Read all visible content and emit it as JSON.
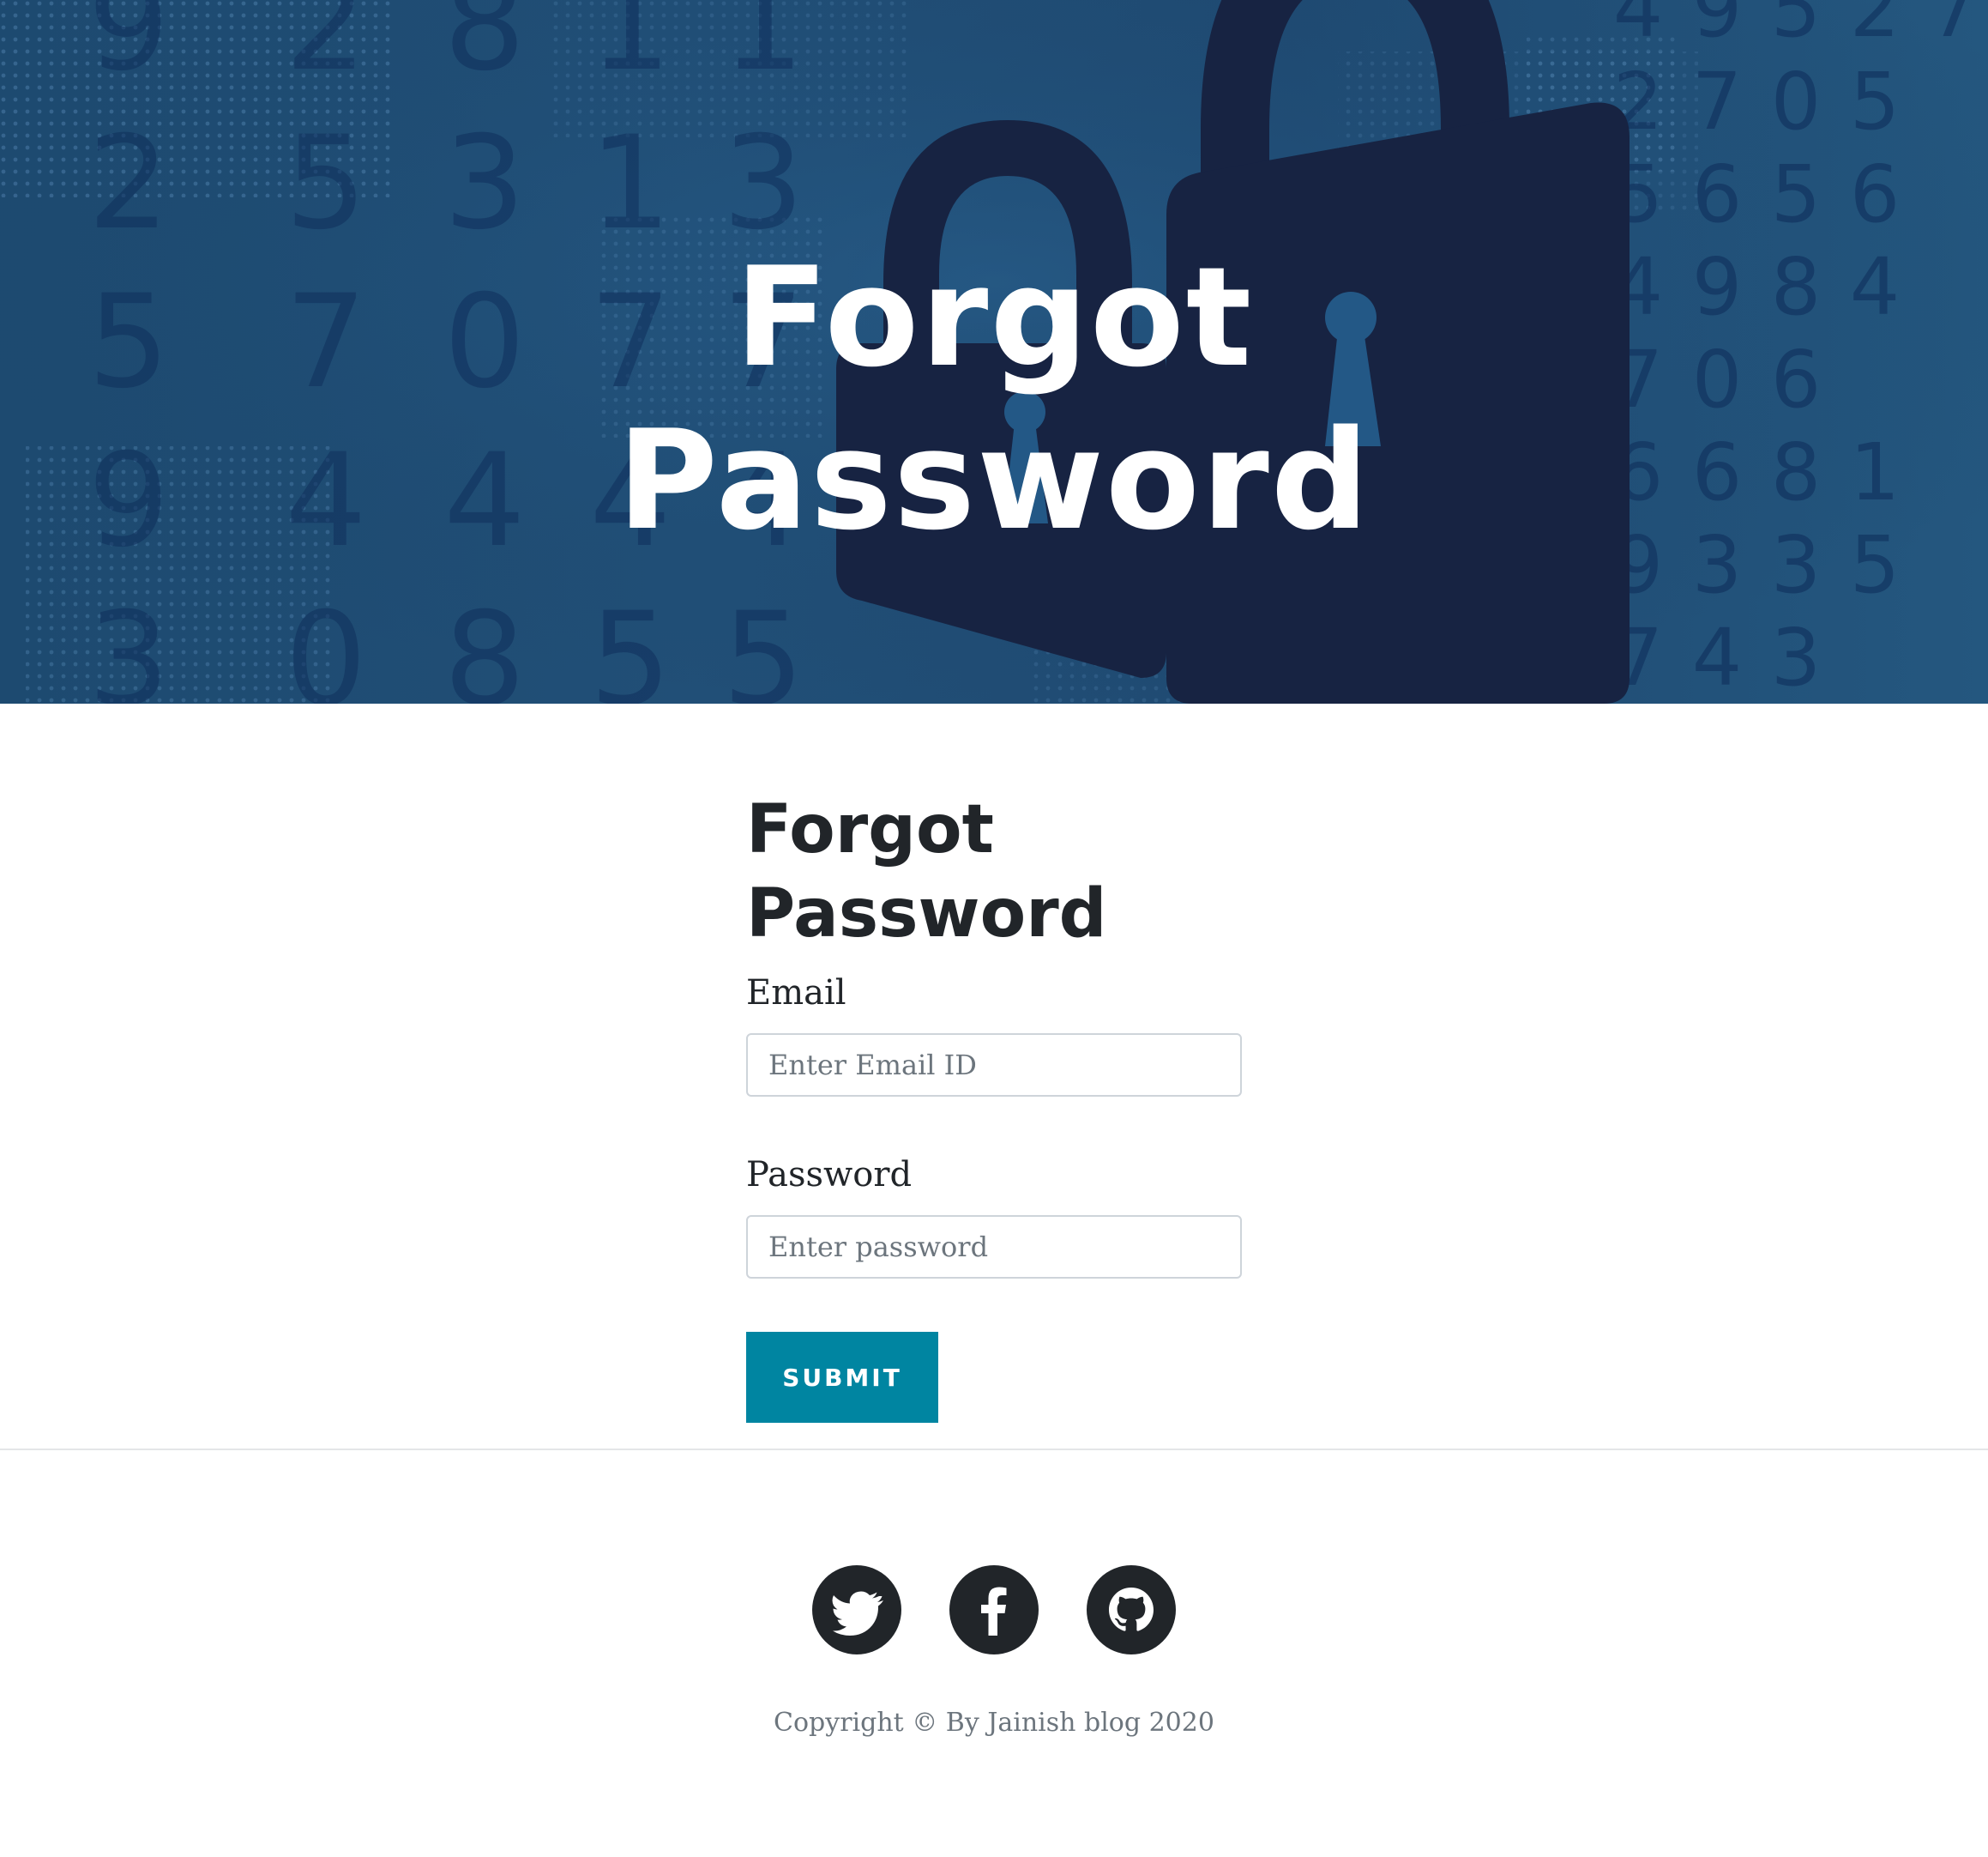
{
  "hero": {
    "title_line1": "Forgot",
    "title_line2": "Password",
    "background_icon": "padlock-icon",
    "background_digits": [
      [
        "9",
        "2",
        "8",
        "1"
      ],
      [
        "2",
        "5",
        "3",
        "1",
        "3"
      ],
      [
        "5",
        "7",
        "0",
        "7"
      ],
      [
        "9",
        "4",
        "4"
      ],
      [
        "3",
        "0",
        "8",
        "5"
      ],
      [
        "4",
        "9",
        "5",
        "2",
        "7"
      ],
      [
        "2",
        "7",
        "0",
        "5"
      ],
      [
        "5",
        "6",
        "5",
        "6"
      ],
      [
        "4",
        "9",
        "8",
        "4"
      ],
      [
        "7",
        "0",
        "6"
      ],
      [
        "6",
        "6",
        "8",
        "1"
      ],
      [
        "9",
        "3",
        "3",
        "5"
      ],
      [
        "7",
        "4",
        "3"
      ]
    ]
  },
  "form": {
    "title_line1": "Forgot",
    "title_line2": "Password",
    "email_label": "Email",
    "email_placeholder": "Enter Email ID",
    "password_label": "Password",
    "password_placeholder": "Enter password",
    "submit_label": "SUBMIT"
  },
  "footer": {
    "social": [
      {
        "name": "twitter",
        "icon": "twitter-icon"
      },
      {
        "name": "facebook",
        "icon": "facebook-icon"
      },
      {
        "name": "github",
        "icon": "github-icon"
      }
    ],
    "copyright": "Copyright © By Jainish blog 2020"
  },
  "colors": {
    "hero_bg": "#1f4b73",
    "padlock": "#172342",
    "accent_button": "#0085a1",
    "text_dark": "#212529",
    "text_muted": "#6c757d",
    "social_circle": "#212529"
  }
}
